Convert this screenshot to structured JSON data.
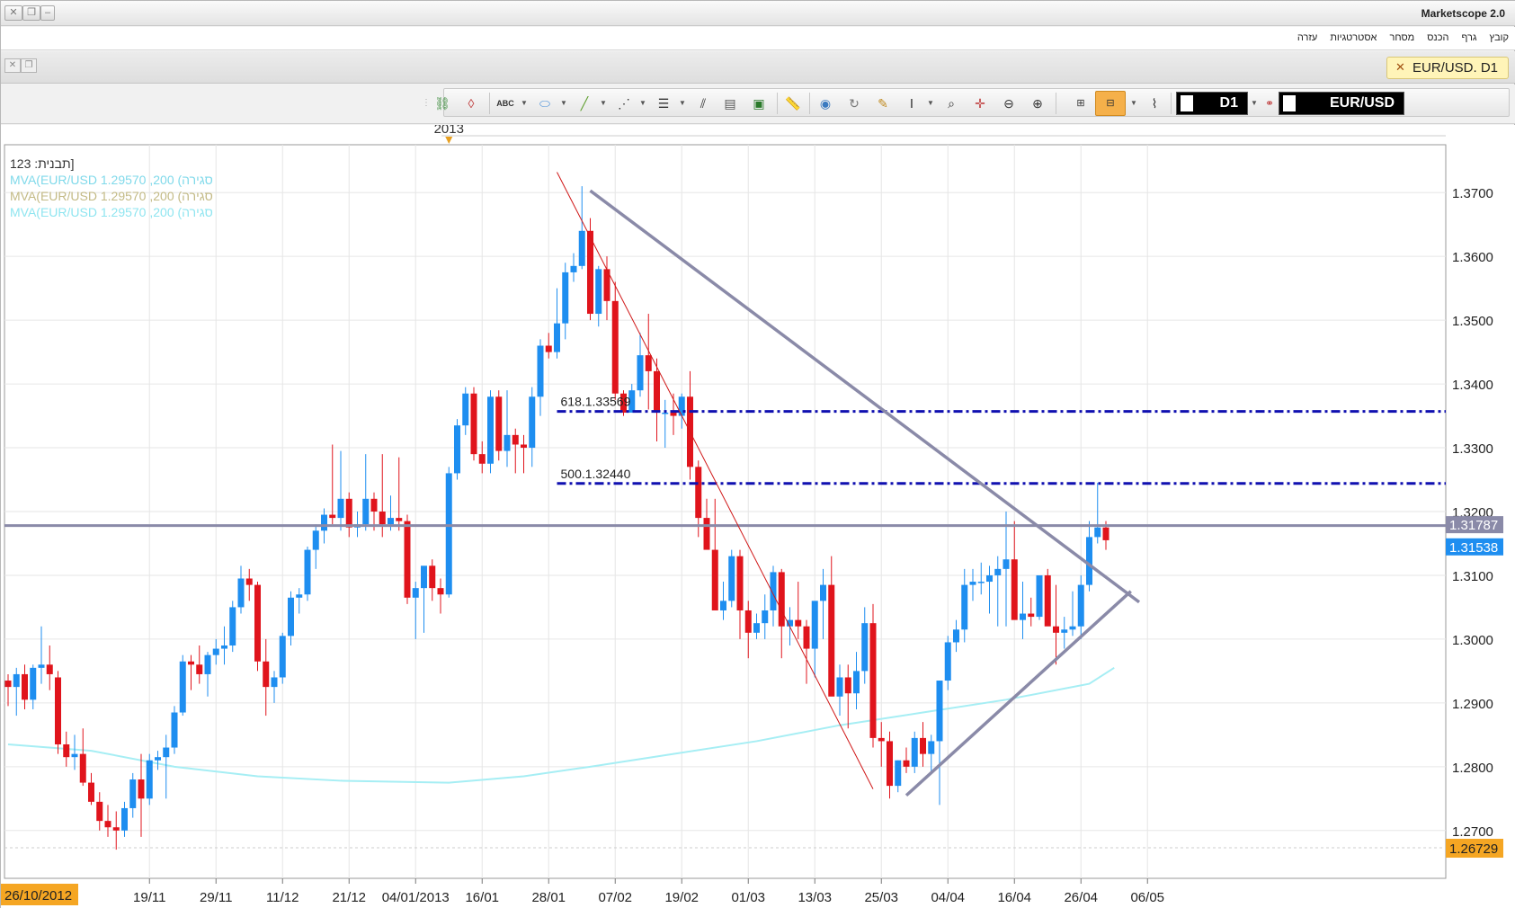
{
  "window": {
    "title": "Marketscope 2.0"
  },
  "menu": {
    "items": [
      "קובץ",
      "גרף",
      "הכנס",
      "מסחר",
      "אסטרטגיות",
      "עזרה"
    ]
  },
  "tab": {
    "label": "EUR/USD. D1"
  },
  "toolbar": {
    "timeframe": "D1",
    "symbol": "EUR/USD"
  },
  "chart_data": {
    "type": "candlestick",
    "symbol": "EUR/USD",
    "timeframe": "D1",
    "legend": [
      "תבנית: 123]",
      "MVA(EUR/USD 1.29570 ,200 (סגירה",
      "MVA(EUR/USD 1.29570 ,200 (סגירה",
      "MVA(EUR/USD 1.29570 ,200 (סגירה"
    ],
    "year_label": "2013",
    "ylim": [
      1.2625,
      1.3775
    ],
    "y_ticks": [
      "1.3700",
      "1.3600",
      "1.3500",
      "1.3400",
      "1.3300",
      "1.3200",
      "1.3100",
      "1.3000",
      "1.2900",
      "1.2800",
      "1.2700"
    ],
    "y_tick_values": [
      1.37,
      1.36,
      1.35,
      1.34,
      1.33,
      1.32,
      1.31,
      1.3,
      1.29,
      1.28,
      1.27
    ],
    "x_ticks": [
      "19/11",
      "29/11",
      "11/12",
      "21/12",
      "04/01/2013",
      "16/01",
      "28/01",
      "07/02",
      "19/02",
      "01/03",
      "13/03",
      "25/03",
      "04/04",
      "16/04",
      "26/04",
      "06/05"
    ],
    "x_tick_index": [
      17,
      25,
      33,
      41,
      49,
      57,
      65,
      73,
      81,
      89,
      97,
      105,
      113,
      121,
      129,
      137
    ],
    "start_date_label": "26/10/2012",
    "price_labels": {
      "ask": {
        "text": "1.31787",
        "value": 1.31787
      },
      "bid": {
        "text": "1.31538",
        "value": 1.31538
      },
      "low": {
        "text": "1.26729",
        "value": 1.26729
      }
    },
    "fib_levels": [
      {
        "label": "618.1.33569",
        "value": 1.33569,
        "from_index": 66
      },
      {
        "label": "500.1.32440",
        "value": 1.3244,
        "from_index": 66
      }
    ],
    "horizontal_line": 1.3178,
    "trendlines": [
      {
        "name": "red-trendline",
        "from": [
          66,
          1.3732
        ],
        "to": [
          104,
          1.2765
        ]
      },
      {
        "name": "upper-triangle-line",
        "from": [
          70,
          1.3703
        ],
        "to": [
          136,
          1.3058
        ]
      },
      {
        "name": "lower-triangle-line",
        "from": [
          108,
          1.2755
        ],
        "to": [
          135,
          1.3075
        ]
      }
    ],
    "moving_average": {
      "name": "MVA 200",
      "points": [
        [
          0,
          1.2835
        ],
        [
          10,
          1.2825
        ],
        [
          20,
          1.28
        ],
        [
          30,
          1.2785
        ],
        [
          40,
          1.2778
        ],
        [
          53,
          1.2775
        ],
        [
          62,
          1.2785
        ],
        [
          70,
          1.28
        ],
        [
          80,
          1.282
        ],
        [
          90,
          1.284
        ],
        [
          100,
          1.2865
        ],
        [
          110,
          1.2885
        ],
        [
          120,
          1.2905
        ],
        [
          130,
          1.293
        ],
        [
          133,
          1.2955
        ]
      ]
    },
    "candles": [
      [
        1.2935,
        1.2945,
        1.2895,
        1.2925
      ],
      [
        1.2925,
        1.2955,
        1.288,
        1.2945
      ],
      [
        1.2945,
        1.296,
        1.289,
        1.2905
      ],
      [
        1.2905,
        1.296,
        1.289,
        1.2955
      ],
      [
        1.2955,
        1.302,
        1.293,
        1.296
      ],
      [
        1.296,
        1.299,
        1.292,
        1.2945
      ],
      [
        1.294,
        1.295,
        1.282,
        1.2835
      ],
      [
        1.2835,
        1.2855,
        1.28,
        1.2815
      ],
      [
        1.2815,
        1.285,
        1.2795,
        1.282
      ],
      [
        1.282,
        1.286,
        1.277,
        1.2775
      ],
      [
        1.2775,
        1.279,
        1.274,
        1.2745
      ],
      [
        1.2745,
        1.276,
        1.27,
        1.2715
      ],
      [
        1.2715,
        1.274,
        1.269,
        1.2705
      ],
      [
        1.2705,
        1.273,
        1.267,
        1.27
      ],
      [
        1.27,
        1.2745,
        1.269,
        1.2735
      ],
      [
        1.2735,
        1.279,
        1.272,
        1.278
      ],
      [
        1.278,
        1.282,
        1.269,
        1.275
      ],
      [
        1.275,
        1.282,
        1.274,
        1.281
      ],
      [
        1.281,
        1.2825,
        1.2795,
        1.2815
      ],
      [
        1.2815,
        1.285,
        1.275,
        1.283
      ],
      [
        1.283,
        1.2895,
        1.282,
        1.2885
      ],
      [
        1.2885,
        1.2975,
        1.288,
        1.2965
      ],
      [
        1.2965,
        1.2975,
        1.292,
        1.296
      ],
      [
        1.296,
        1.299,
        1.293,
        1.2945
      ],
      [
        1.2945,
        1.298,
        1.291,
        1.2975
      ],
      [
        1.2975,
        1.3,
        1.296,
        1.2985
      ],
      [
        1.2985,
        1.302,
        1.296,
        1.299
      ],
      [
        1.299,
        1.306,
        1.298,
        1.305
      ],
      [
        1.305,
        1.3115,
        1.304,
        1.3095
      ],
      [
        1.3095,
        1.311,
        1.306,
        1.3085
      ],
      [
        1.3085,
        1.309,
        1.295,
        1.2965
      ],
      [
        1.2965,
        1.3,
        1.288,
        1.2925
      ],
      [
        1.2925,
        1.295,
        1.29,
        1.294
      ],
      [
        1.294,
        1.301,
        1.293,
        1.3005
      ],
      [
        1.3005,
        1.3075,
        1.299,
        1.3065
      ],
      [
        1.3065,
        1.308,
        1.304,
        1.307
      ],
      [
        1.307,
        1.3145,
        1.306,
        1.314
      ],
      [
        1.314,
        1.318,
        1.311,
        1.317
      ],
      [
        1.317,
        1.3205,
        1.315,
        1.3195
      ],
      [
        1.3195,
        1.3305,
        1.318,
        1.319
      ],
      [
        1.319,
        1.3295,
        1.317,
        1.322
      ],
      [
        1.322,
        1.323,
        1.316,
        1.3175
      ],
      [
        1.3175,
        1.32,
        1.316,
        1.318
      ],
      [
        1.318,
        1.329,
        1.317,
        1.322
      ],
      [
        1.322,
        1.323,
        1.317,
        1.32
      ],
      [
        1.32,
        1.329,
        1.316,
        1.318
      ],
      [
        1.318,
        1.3225,
        1.317,
        1.319
      ],
      [
        1.319,
        1.3285,
        1.317,
        1.3185
      ],
      [
        1.3185,
        1.3195,
        1.3055,
        1.3065
      ],
      [
        1.3065,
        1.309,
        1.3,
        1.308
      ],
      [
        1.308,
        1.3105,
        1.301,
        1.3115
      ],
      [
        1.3115,
        1.3125,
        1.306,
        1.308
      ],
      [
        1.308,
        1.3095,
        1.304,
        1.307
      ],
      [
        1.307,
        1.327,
        1.3065,
        1.326
      ],
      [
        1.326,
        1.3345,
        1.325,
        1.3335
      ],
      [
        1.3335,
        1.3395,
        1.332,
        1.3385
      ],
      [
        1.3385,
        1.3395,
        1.328,
        1.329
      ],
      [
        1.329,
        1.331,
        1.326,
        1.3275
      ],
      [
        1.3275,
        1.339,
        1.326,
        1.338
      ],
      [
        1.338,
        1.339,
        1.328,
        1.3295
      ],
      [
        1.3295,
        1.339,
        1.327,
        1.332
      ],
      [
        1.332,
        1.333,
        1.326,
        1.3305
      ],
      [
        1.3305,
        1.332,
        1.326,
        1.33
      ],
      [
        1.33,
        1.3395,
        1.327,
        1.338
      ],
      [
        1.338,
        1.347,
        1.335,
        1.346
      ],
      [
        1.346,
        1.348,
        1.344,
        1.345
      ],
      [
        1.345,
        1.355,
        1.344,
        1.3495
      ],
      [
        1.3495,
        1.359,
        1.347,
        1.3575
      ],
      [
        1.3575,
        1.3605,
        1.356,
        1.3585
      ],
      [
        1.3585,
        1.371,
        1.358,
        1.364
      ],
      [
        1.364,
        1.366,
        1.35,
        1.351
      ],
      [
        1.351,
        1.3585,
        1.349,
        1.358
      ],
      [
        1.358,
        1.36,
        1.35,
        1.353
      ],
      [
        1.353,
        1.356,
        1.3375,
        1.3385
      ],
      [
        1.3385,
        1.339,
        1.335,
        1.3355
      ],
      [
        1.3355,
        1.34,
        1.3355,
        1.339
      ],
      [
        1.339,
        1.348,
        1.338,
        1.3445
      ],
      [
        1.3445,
        1.351,
        1.336,
        1.342
      ],
      [
        1.342,
        1.344,
        1.331,
        1.3355
      ],
      [
        1.3355,
        1.3375,
        1.33,
        1.3355
      ],
      [
        1.3355,
        1.3385,
        1.332,
        1.335
      ],
      [
        1.335,
        1.3385,
        1.333,
        1.338
      ],
      [
        1.338,
        1.342,
        1.325,
        1.327
      ],
      [
        1.327,
        1.328,
        1.316,
        1.319
      ],
      [
        1.319,
        1.322,
        1.315,
        1.314
      ],
      [
        1.314,
        1.322,
        1.312,
        1.3045
      ],
      [
        1.3045,
        1.309,
        1.303,
        1.306
      ],
      [
        1.306,
        1.314,
        1.305,
        1.313
      ],
      [
        1.313,
        1.314,
        1.3,
        1.3045
      ],
      [
        1.3045,
        1.306,
        1.297,
        1.301
      ],
      [
        1.301,
        1.304,
        1.3,
        1.3025
      ],
      [
        1.3025,
        1.307,
        1.3,
        1.3045
      ],
      [
        1.3045,
        1.3115,
        1.302,
        1.3105
      ],
      [
        1.3105,
        1.311,
        1.297,
        1.302
      ],
      [
        1.302,
        1.305,
        1.299,
        1.303
      ],
      [
        1.303,
        1.309,
        1.3,
        1.302
      ],
      [
        1.302,
        1.303,
        1.293,
        1.2985
      ],
      [
        1.2985,
        1.301,
        1.294,
        1.306
      ],
      [
        1.306,
        1.311,
        1.3,
        1.3085
      ],
      [
        1.3085,
        1.313,
        1.294,
        1.291
      ],
      [
        1.291,
        1.296,
        1.288,
        1.294
      ],
      [
        1.294,
        1.296,
        1.286,
        1.2915
      ],
      [
        1.2915,
        1.298,
        1.289,
        1.295
      ],
      [
        1.295,
        1.305,
        1.293,
        1.3025
      ],
      [
        1.3025,
        1.3055,
        1.283,
        1.2845
      ],
      [
        1.2845,
        1.287,
        1.28,
        1.284
      ],
      [
        1.284,
        1.2855,
        1.275,
        1.277
      ],
      [
        1.277,
        1.281,
        1.276,
        1.281
      ],
      [
        1.281,
        1.283,
        1.279,
        1.28
      ],
      [
        1.28,
        1.2855,
        1.279,
        1.2845
      ],
      [
        1.2845,
        1.287,
        1.28,
        1.282
      ],
      [
        1.282,
        1.285,
        1.279,
        1.284
      ],
      [
        1.284,
        1.2935,
        1.274,
        1.2935
      ],
      [
        1.2935,
        1.3005,
        1.292,
        1.2995
      ],
      [
        1.2995,
        1.303,
        1.298,
        1.3015
      ],
      [
        1.3015,
        1.311,
        1.2995,
        1.3085
      ],
      [
        1.3085,
        1.311,
        1.306,
        1.309
      ],
      [
        1.309,
        1.312,
        1.307,
        1.309
      ],
      [
        1.309,
        1.3115,
        1.304,
        1.31
      ],
      [
        1.31,
        1.313,
        1.302,
        1.311
      ],
      [
        1.311,
        1.32,
        1.302,
        1.3125
      ],
      [
        1.3125,
        1.3185,
        1.3035,
        1.303
      ],
      [
        1.303,
        1.309,
        1.3,
        1.304
      ],
      [
        1.304,
        1.3065,
        1.302,
        1.3035
      ],
      [
        1.3035,
        1.31,
        1.303,
        1.31
      ],
      [
        1.31,
        1.311,
        1.303,
        1.302
      ],
      [
        1.302,
        1.3085,
        1.296,
        1.301
      ],
      [
        1.301,
        1.3035,
        1.2985,
        1.3015
      ],
      [
        1.3015,
        1.3075,
        1.3005,
        1.302
      ],
      [
        1.302,
        1.31,
        1.3,
        1.3085
      ],
      [
        1.3085,
        1.3185,
        1.3075,
        1.316
      ],
      [
        1.316,
        1.3245,
        1.315,
        1.3175
      ],
      [
        1.3175,
        1.3185,
        1.314,
        1.3155
      ]
    ]
  }
}
